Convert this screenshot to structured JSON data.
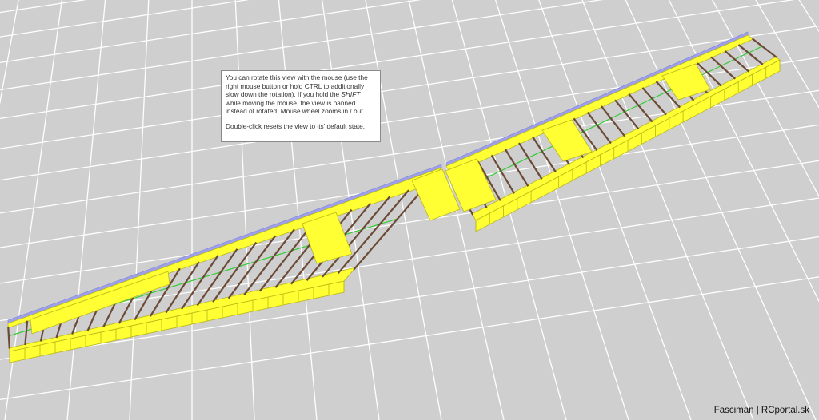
{
  "colors": {
    "background": "#cfcfcf",
    "grid": "#ffffff",
    "sheeting": "#ffff33",
    "sheeting_edge": "#b8b815",
    "rib": "#6b4a36",
    "spar": "#999999",
    "leading_edge": "#9ea0ea",
    "center_line": "#33cc33"
  },
  "help": {
    "line1_a": "You can rotate this view with the mouse (use the right mouse button or hold CTRL to additionally slow down the rotation). If you hold the ",
    "line1_em": "SHIFT",
    "line1_b": " while moving the mouse, the view is panned instead of rotated. Mouse wheel zooms in / out.",
    "line2": "Double-click resets the view to its' default state."
  },
  "credit": "Fasciman | RCportal.sk"
}
